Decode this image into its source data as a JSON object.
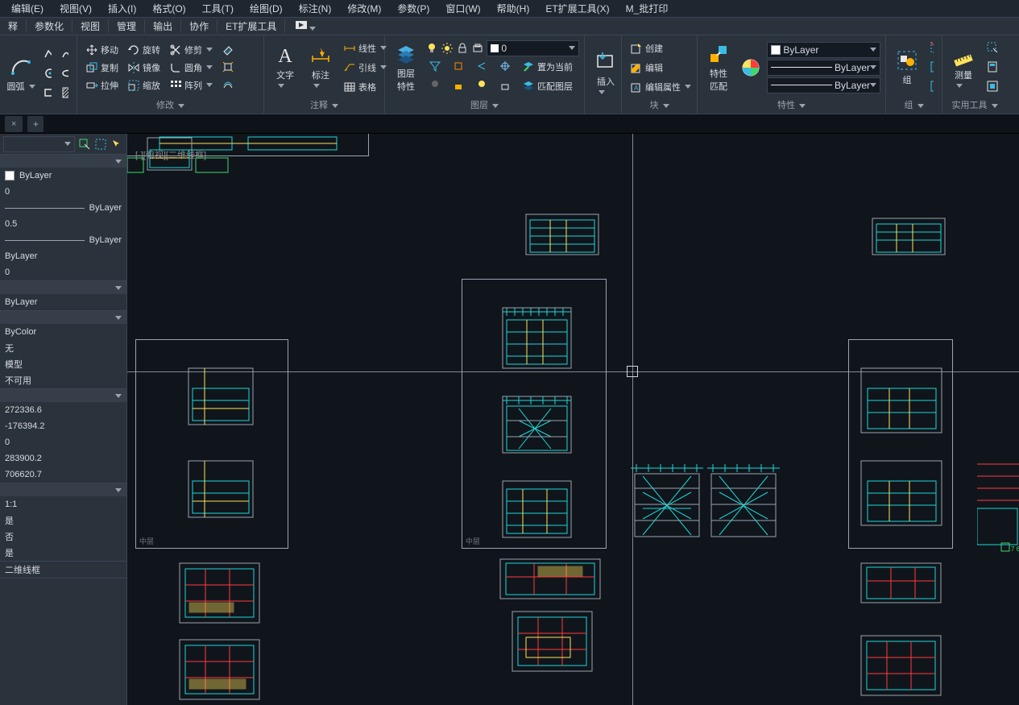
{
  "menubar": [
    "编辑(E)",
    "视图(V)",
    "插入(I)",
    "格式(O)",
    "工具(T)",
    "绘图(D)",
    "标注(N)",
    "修改(M)",
    "参数(P)",
    "窗口(W)",
    "帮助(H)",
    "ET扩展工具(X)",
    "M_批打印"
  ],
  "tabs": [
    "释",
    "参数化",
    "视图",
    "管理",
    "输出",
    "协作",
    "ET扩展工具"
  ],
  "ribbon": {
    "draw": {
      "arc": "圆弧",
      "title": ""
    },
    "modify": {
      "move": "移动",
      "rotate": "旋转",
      "trim": "修剪",
      "copy": "复制",
      "mirror": "镜像",
      "fillet": "圆角",
      "stretch": "拉伸",
      "scale": "缩放",
      "array": "阵列",
      "title": "修改"
    },
    "annot": {
      "text": "文字",
      "dim": "标注",
      "line": "线性",
      "leader": "引线",
      "table": "表格",
      "title": "注释"
    },
    "layer": {
      "props": "图层\n特性",
      "sel": "0",
      "setcur": "置为当前",
      "match": "匹配图层",
      "title": "图层"
    },
    "insert": {
      "insert": "插入",
      "title": ""
    },
    "block": {
      "create": "创建",
      "edit": "编辑",
      "editattr": "编辑属性",
      "title": "块"
    },
    "props": {
      "match": "特性\n匹配",
      "bylayer": "ByLayer",
      "title": "特性"
    },
    "group": {
      "group": "组",
      "title": "组"
    },
    "util": {
      "measure": "测量",
      "title": "实用工具"
    }
  },
  "doc": {
    "close": "×",
    "new": "+"
  },
  "vplabel": "[-][俯视][二维线框]",
  "side": {
    "color": "ByLayer",
    "layer0": "0",
    "ltByLayer": "ByLayer",
    "ltscale": "0.5",
    "lwByLayer": "ByLayer",
    "tsByLayer": "ByLayer",
    "transp0": "0",
    "mat": "ByLayer",
    "pstyle": "ByColor",
    "shadow": "无",
    "vstyle": "模型",
    "vnone": "不可用",
    "cx": "272336.6",
    "cy": "-176394.2",
    "cz": "0",
    "h": "283900.2",
    "w": "706620.7",
    "scale": "1:1",
    "yes": "是",
    "no": "否",
    "wf": "二维线框"
  },
  "mini": "中层"
}
